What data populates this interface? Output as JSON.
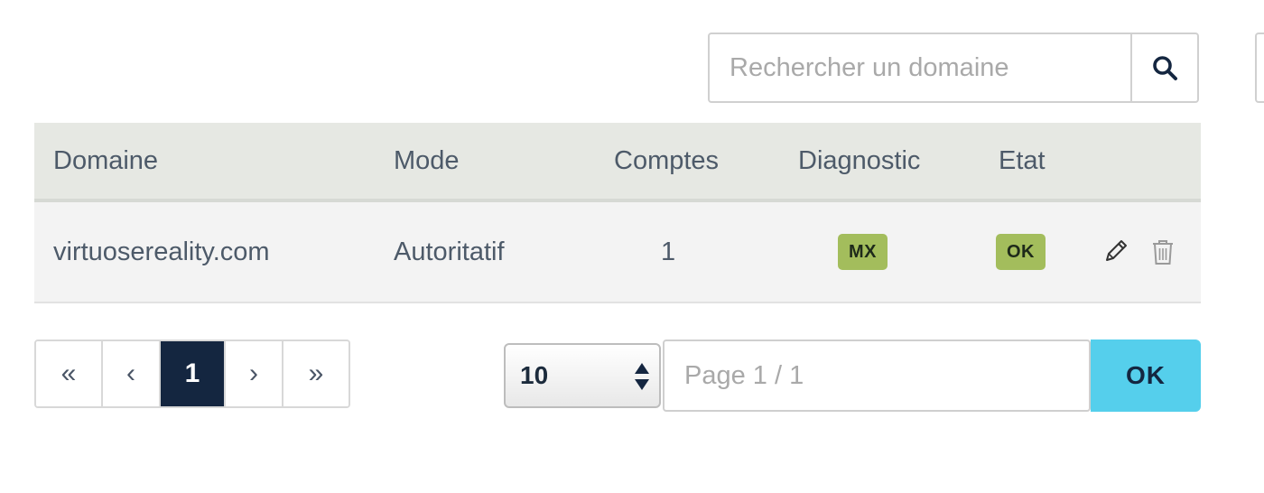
{
  "search": {
    "placeholder": "Rechercher un domaine",
    "value": ""
  },
  "table": {
    "columns": [
      "Domaine",
      "Mode",
      "Comptes",
      "Diagnostic",
      "Etat"
    ],
    "rows": [
      {
        "domain": "virtuosereality.com",
        "mode": "Autoritatif",
        "accounts": "1",
        "diagnostic": "MX",
        "state": "OK"
      }
    ]
  },
  "pagination": {
    "first": "«",
    "prev": "‹",
    "current": "1",
    "next": "›",
    "last": "»"
  },
  "page_size": {
    "selected": "10"
  },
  "page_jump": {
    "placeholder": "Page 1 / 1",
    "value": "",
    "submit_label": "OK"
  },
  "icons": {
    "search": "search-icon",
    "edit": "pencil-icon",
    "delete": "trash-icon",
    "select": "sort-arrows-icon"
  },
  "colors": {
    "header_bg": "#e6e8e3",
    "row_bg": "#f3f3f3",
    "badge_green": "#a3bd5c",
    "active_page": "#142640",
    "ok_button": "#55cfec"
  }
}
